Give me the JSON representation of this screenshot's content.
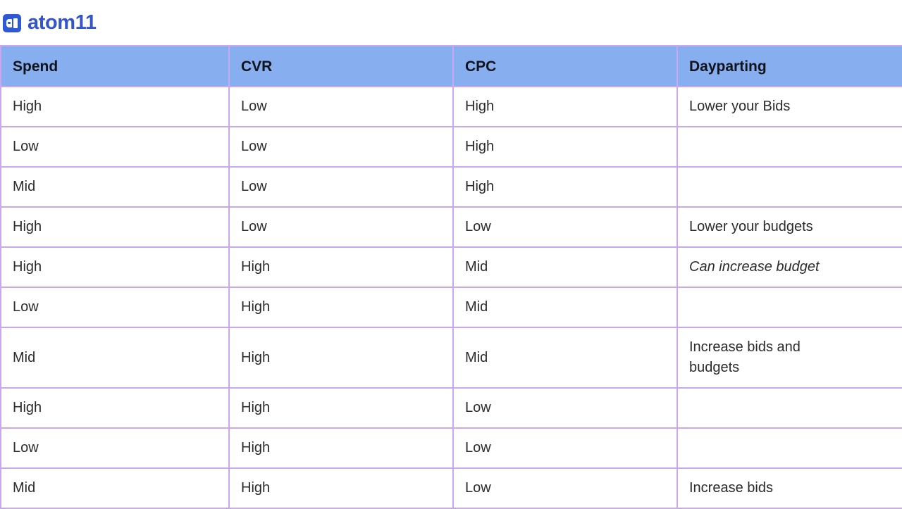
{
  "brand": {
    "logo_icon": "atom11-logo-icon",
    "name": "atom11",
    "logo_color": "#2F58D6",
    "name_color": "#3355CC"
  },
  "table": {
    "header_bg": "#87AFF0",
    "border_color": "#C9A8F0",
    "columns": [
      {
        "key": "spend",
        "label": "Spend"
      },
      {
        "key": "cvr",
        "label": "CVR"
      },
      {
        "key": "cpc",
        "label": "CPC"
      },
      {
        "key": "dayparting",
        "label": "Dayparting"
      }
    ],
    "rows": [
      {
        "spend": "High",
        "cvr": "Low",
        "cpc": "High",
        "dayparting": "Lower your Bids"
      },
      {
        "spend": "Low",
        "cvr": "Low",
        "cpc": "High",
        "dayparting": ""
      },
      {
        "spend": "Mid",
        "cvr": "Low",
        "cpc": "High",
        "dayparting": ""
      },
      {
        "spend": "High",
        "cvr": "Low",
        "cpc": "Low",
        "dayparting": "Lower your budgets"
      },
      {
        "spend": "High",
        "cvr": "High",
        "cpc": "Mid",
        "dayparting": "Can increase budget"
      },
      {
        "spend": "Low",
        "cvr": "High",
        "cpc": "Mid",
        "dayparting": ""
      },
      {
        "spend": "Mid",
        "cvr": "High",
        "cpc": "Mid",
        "dayparting": "Increase bids and budgets"
      },
      {
        "spend": "High",
        "cvr": "High",
        "cpc": "Low",
        "dayparting": ""
      },
      {
        "spend": "Low",
        "cvr": "High",
        "cpc": "Low",
        "dayparting": ""
      },
      {
        "spend": "Mid",
        "cvr": "High",
        "cpc": "Low",
        "dayparting": "Increase bids"
      }
    ]
  }
}
